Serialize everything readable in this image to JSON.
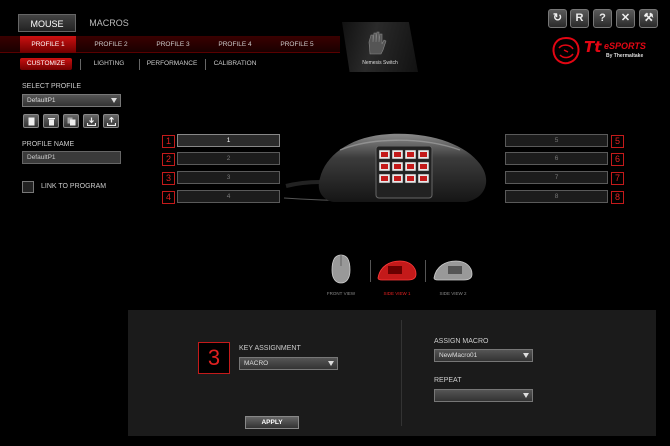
{
  "header": {
    "tabs": [
      {
        "label": "MOUSE",
        "active": true
      },
      {
        "label": "MACROS",
        "active": false
      }
    ],
    "window_buttons": [
      "refresh-icon",
      "reset-icon",
      "help-icon",
      "close-icon",
      "tools-icon"
    ],
    "window_button_glyphs": [
      "↻",
      "R",
      "?",
      "✕",
      "⚒"
    ]
  },
  "profiles": {
    "tabs": [
      "PROFILE 1",
      "PROFILE 2",
      "PROFILE 3",
      "PROFILE 4",
      "PROFILE 5"
    ],
    "active_index": 0
  },
  "subtabs": {
    "items": [
      "CUSTOMIZE",
      "LIGHTING",
      "PERFORMANCE",
      "CALIBRATION"
    ],
    "active_index": 0
  },
  "nemesis": {
    "label": "Nemesis Switch"
  },
  "logo": {
    "tt": "Tt",
    "brand": "eSPORTS",
    "by": "By Thermaltake"
  },
  "left_panel": {
    "select_profile_label": "SELECT PROFILE",
    "select_profile_value": "DefaultP1",
    "profile_name_label": "PROFILE NAME",
    "profile_name_value": "DefaultP1",
    "link_label": "LINK TO PROGRAM"
  },
  "slots": {
    "left": [
      {
        "num": "1",
        "value": "1",
        "active": true
      },
      {
        "num": "2",
        "value": "2",
        "active": false
      },
      {
        "num": "3",
        "value": "3",
        "active": false
      },
      {
        "num": "4",
        "value": "4",
        "active": false
      }
    ],
    "right": [
      {
        "num": "5",
        "value": "5"
      },
      {
        "num": "6",
        "value": "6"
      },
      {
        "num": "7",
        "value": "7"
      },
      {
        "num": "8",
        "value": "8"
      }
    ]
  },
  "views": {
    "items": [
      "FRONT VIEW",
      "SIDE VIEW 1",
      "SIDE VIEW 2"
    ],
    "active_index": 1
  },
  "assignment": {
    "selected_num": "3",
    "key_assignment_label": "KEY ASSIGNMENT",
    "key_assignment_value": "MACRO",
    "assign_macro_label": "ASSIGN MACRO",
    "assign_macro_value": "NewMacro01",
    "repeat_label": "REPEAT",
    "repeat_value": "",
    "apply_label": "APPLY"
  },
  "colors": {
    "accent": "#e02020",
    "bar": "#7a0000"
  }
}
